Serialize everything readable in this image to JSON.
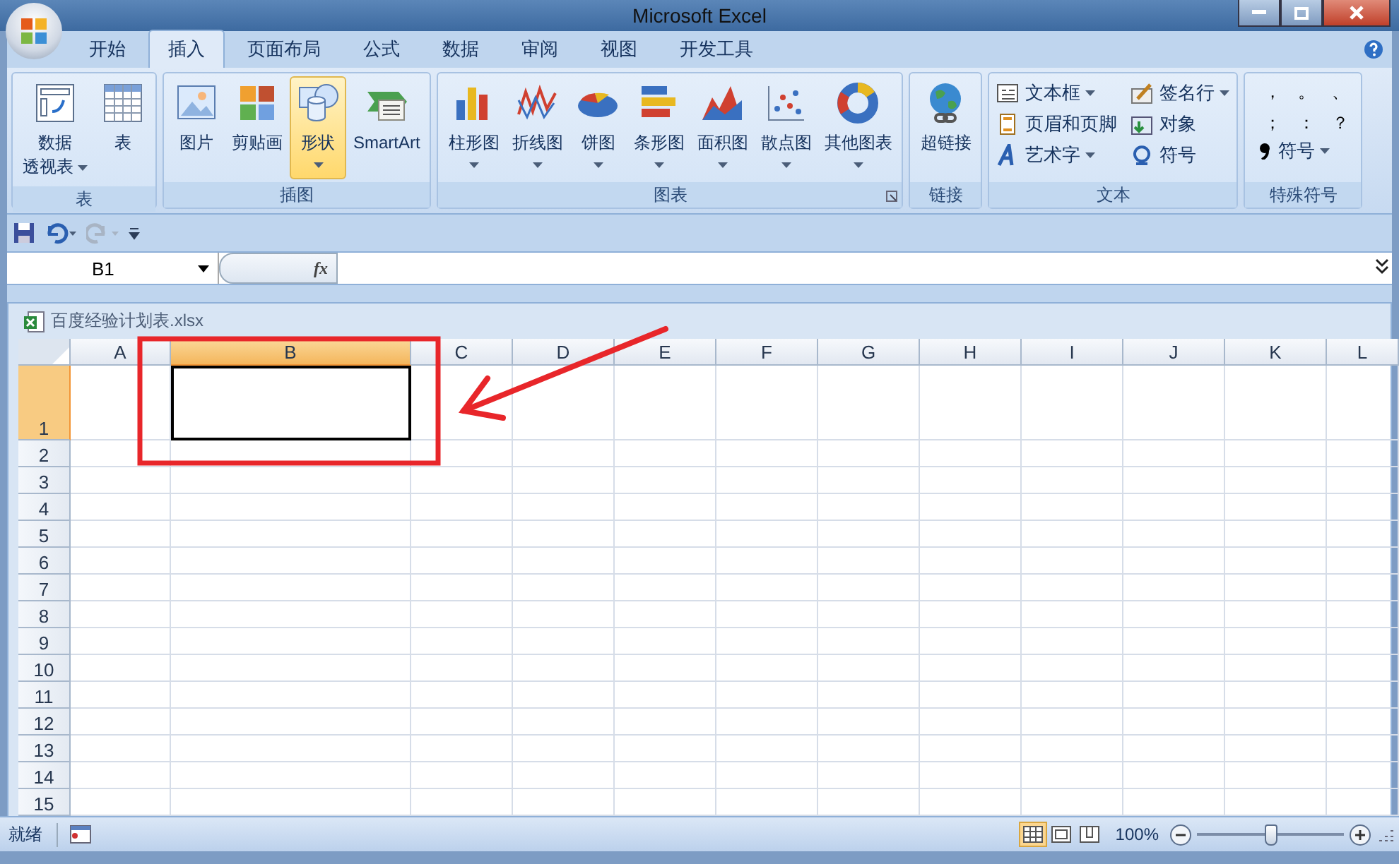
{
  "window": {
    "title": "Microsoft Excel"
  },
  "tabs": [
    {
      "label": "开始",
      "selected": false
    },
    {
      "label": "插入",
      "selected": true
    },
    {
      "label": "页面布局",
      "selected": false
    },
    {
      "label": "公式",
      "selected": false
    },
    {
      "label": "数据",
      "selected": false
    },
    {
      "label": "审阅",
      "selected": false
    },
    {
      "label": "视图",
      "selected": false
    },
    {
      "label": "开发工具",
      "selected": false
    }
  ],
  "ribbon_groups": [
    {
      "label": "表",
      "items": [
        {
          "kind": "large",
          "lines": [
            "数据",
            "透视表"
          ],
          "dropdown": true,
          "selected": false
        },
        {
          "kind": "large",
          "lines": [
            "表"
          ],
          "dropdown": false,
          "selected": false
        }
      ]
    },
    {
      "label": "插图",
      "items": [
        {
          "kind": "large",
          "lines": [
            "图片"
          ],
          "dropdown": false,
          "selected": false
        },
        {
          "kind": "large",
          "lines": [
            "剪贴画"
          ],
          "dropdown": false,
          "selected": false
        },
        {
          "kind": "large",
          "lines": [
            "形状"
          ],
          "dropdown": true,
          "selected": true
        },
        {
          "kind": "large",
          "lines": [
            "SmartArt"
          ],
          "dropdown": false,
          "selected": false
        }
      ]
    },
    {
      "label": "图表",
      "launcher": true,
      "items": [
        {
          "kind": "large",
          "lines": [
            "柱形图"
          ],
          "dropdown": true,
          "selected": false
        },
        {
          "kind": "large",
          "lines": [
            "折线图"
          ],
          "dropdown": true,
          "selected": false
        },
        {
          "kind": "large",
          "lines": [
            "饼图"
          ],
          "dropdown": true,
          "selected": false
        },
        {
          "kind": "large",
          "lines": [
            "条形图"
          ],
          "dropdown": true,
          "selected": false
        },
        {
          "kind": "large",
          "lines": [
            "面积图"
          ],
          "dropdown": true,
          "selected": false
        },
        {
          "kind": "large",
          "lines": [
            "散点图"
          ],
          "dropdown": true,
          "selected": false
        },
        {
          "kind": "large",
          "lines": [
            "其他图表"
          ],
          "dropdown": true,
          "selected": false
        }
      ]
    },
    {
      "label": "链接",
      "items": [
        {
          "kind": "large",
          "lines": [
            "超链接"
          ],
          "dropdown": false,
          "selected": false
        }
      ]
    },
    {
      "label": "文本",
      "items": [
        {
          "kind": "small",
          "lines": [
            "文本框"
          ],
          "dropdown": true
        },
        {
          "kind": "small",
          "lines": [
            "页眉和页脚"
          ],
          "dropdown": false
        },
        {
          "kind": "small",
          "lines": [
            "艺术字"
          ],
          "dropdown": true
        },
        {
          "kind": "small",
          "lines": [
            "签名行"
          ],
          "dropdown": true
        },
        {
          "kind": "small",
          "lines": [
            "对象"
          ],
          "dropdown": false
        },
        {
          "kind": "small",
          "lines": [
            "符号"
          ],
          "dropdown": false
        }
      ]
    },
    {
      "label": "特殊符号",
      "items": [
        {
          "kind": "symbols",
          "symbols": [
            "，",
            "。",
            "、",
            "；",
            "：",
            "？"
          ]
        },
        {
          "kind": "small",
          "lines": [
            "符号"
          ],
          "dropdown": true
        }
      ]
    }
  ],
  "quick_access": [
    {
      "kind": "save",
      "disabled": false
    },
    {
      "kind": "undo",
      "disabled": false
    },
    {
      "kind": "redo",
      "disabled": true
    },
    {
      "kind": "customize",
      "disabled": false
    }
  ],
  "formula_bar": {
    "name_box": "B1",
    "function_label": "fx"
  },
  "workbook": {
    "title": "百度经验计划表.xlsx",
    "columns": [
      {
        "label": "A",
        "selected": false
      },
      {
        "label": "B",
        "selected": true
      },
      {
        "label": "C",
        "selected": false
      },
      {
        "label": "D",
        "selected": false
      },
      {
        "label": "E",
        "selected": false
      },
      {
        "label": "F",
        "selected": false
      },
      {
        "label": "G",
        "selected": false
      },
      {
        "label": "H",
        "selected": false
      },
      {
        "label": "I",
        "selected": false
      },
      {
        "label": "J",
        "selected": false
      },
      {
        "label": "K",
        "selected": false
      },
      {
        "label": "L",
        "selected": false
      }
    ],
    "rows": [
      {
        "label": "1",
        "selected": true
      },
      {
        "label": "2",
        "selected": false
      },
      {
        "label": "3",
        "selected": false
      },
      {
        "label": "4",
        "selected": false
      },
      {
        "label": "5",
        "selected": false
      },
      {
        "label": "6",
        "selected": false
      },
      {
        "label": "7",
        "selected": false
      },
      {
        "label": "8",
        "selected": false
      },
      {
        "label": "9",
        "selected": false
      },
      {
        "label": "10",
        "selected": false
      },
      {
        "label": "11",
        "selected": false
      },
      {
        "label": "12",
        "selected": false
      },
      {
        "label": "13",
        "selected": false
      },
      {
        "label": "14",
        "selected": false
      },
      {
        "label": "15",
        "selected": false
      }
    ],
    "annotation": {
      "kind": "frame_and_arrow"
    }
  },
  "status_bar": {
    "status": "就绪",
    "views": [
      {
        "kind": "normal",
        "selected": true
      },
      {
        "kind": "page_layout",
        "selected": false
      },
      {
        "kind": "page_break",
        "selected": false
      }
    ],
    "zoom": "100%",
    "zoom_slider": {
      "level": 0.5
    }
  }
}
